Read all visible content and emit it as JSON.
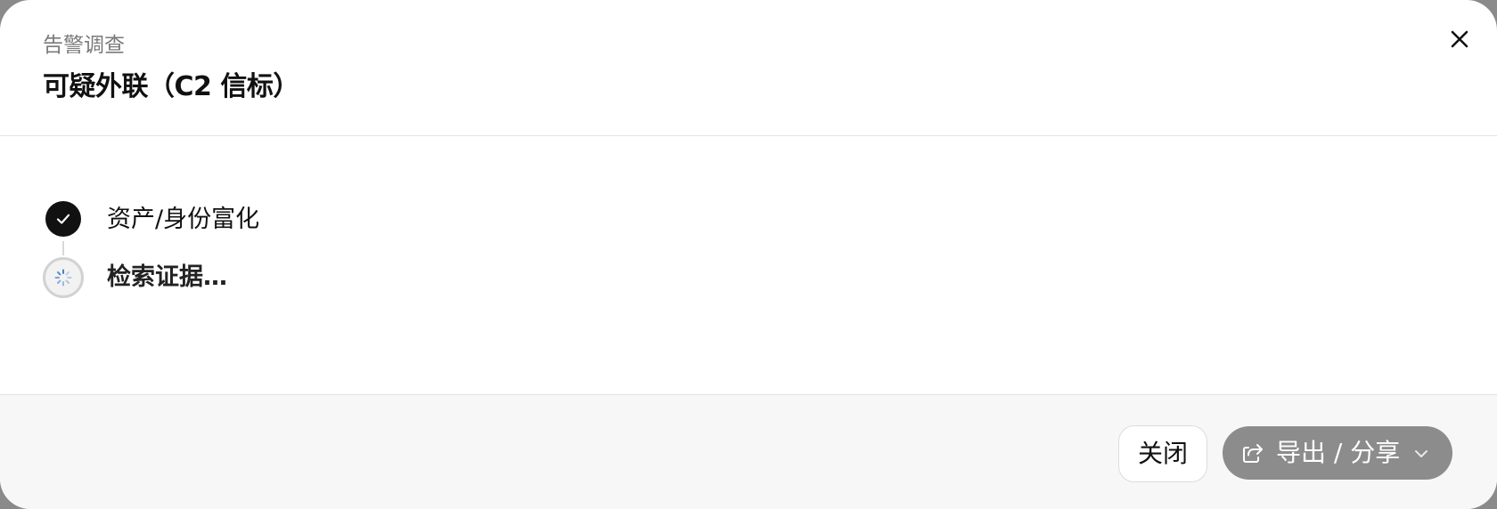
{
  "dialog": {
    "eyebrow": "告警调查",
    "title": "可疑外联（C2 信标）"
  },
  "steps": [
    {
      "label": "资产/身份富化",
      "status": "done",
      "icon": "check-icon"
    },
    {
      "label": "检索证据…",
      "status": "running",
      "icon": "spinner-icon"
    }
  ],
  "footer": {
    "close_label": "关闭",
    "export_label": "导出 / 分享",
    "export_icon": "share-icon",
    "export_chevron": "chevron-down-icon"
  },
  "colors": {
    "accent_dark": "#111111",
    "export_button": "#8c8c8c",
    "spinner": "#4a7fd0"
  }
}
